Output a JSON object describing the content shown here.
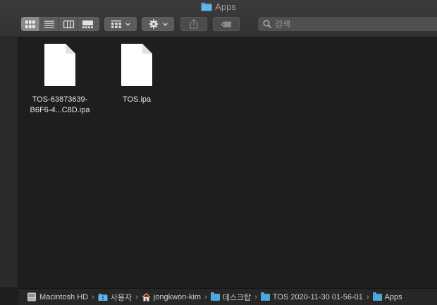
{
  "window": {
    "title": "Apps"
  },
  "toolbar": {
    "view_buttons": [
      {
        "icon": "icon-view-icon",
        "active": true
      },
      {
        "icon": "list-view-icon",
        "active": false
      },
      {
        "icon": "column-view-icon",
        "active": false
      },
      {
        "icon": "gallery-view-icon",
        "active": false
      }
    ],
    "group_icon": "group-grid-icon",
    "action_icon": "gear-icon",
    "share_icon": "share-icon",
    "tag_icon": "tag-icon"
  },
  "search": {
    "placeholder": "검색",
    "value": ""
  },
  "files": [
    {
      "name": "TOS-63873639-\nB6F6-4...C8D.ipa"
    },
    {
      "name": "TOS.ipa"
    }
  ],
  "pathbar": {
    "items": [
      {
        "label": "Macintosh HD",
        "icon": "hard-drive-icon"
      },
      {
        "label": "사용자",
        "icon": "folder-icon"
      },
      {
        "label": "jongkwon-kim",
        "icon": "home-icon"
      },
      {
        "label": "데스크탑",
        "icon": "folder-icon"
      },
      {
        "label": "TOS 2020-11-30 01-56-01",
        "icon": "folder-icon"
      },
      {
        "label": "Apps",
        "icon": "folder-icon"
      }
    ],
    "separator": "›"
  },
  "colors": {
    "folder_blue": "#4ea6dc",
    "background": "#1e1e1e",
    "toolbar": "#353535"
  }
}
